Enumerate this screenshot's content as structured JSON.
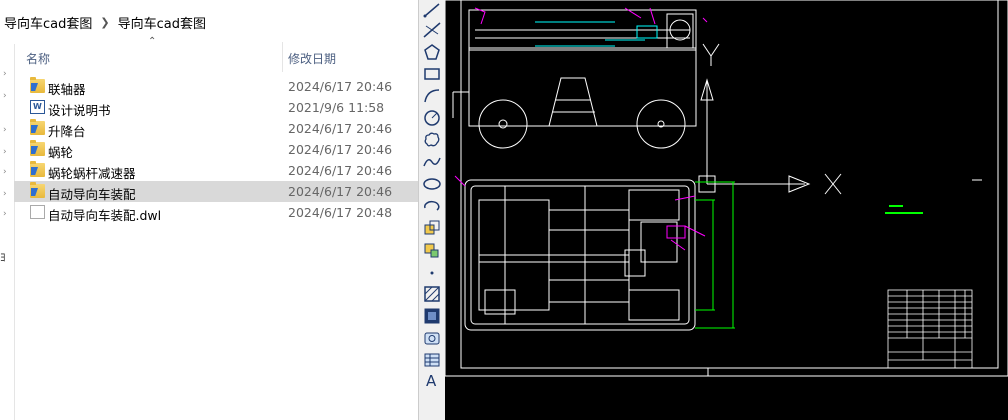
{
  "explorer": {
    "breadcrumb": [
      "导向车cad套图",
      "导向车cad套图"
    ],
    "columns": {
      "name": "名称",
      "date": "修改日期"
    },
    "left_pane_label": "ﾖ",
    "files": [
      {
        "name": "联轴器",
        "date": "2024/6/17 20:46",
        "icon": "folder-icon",
        "selected": false
      },
      {
        "name": "设计说明书",
        "date": "2021/9/6 11:58",
        "icon": "word-doc-icon",
        "selected": false
      },
      {
        "name": "升降台",
        "date": "2024/6/17 20:46",
        "icon": "folder-icon",
        "selected": false
      },
      {
        "name": "蜗轮",
        "date": "2024/6/17 20:46",
        "icon": "folder-icon",
        "selected": false
      },
      {
        "name": "蜗轮蜗杆减速器",
        "date": "2024/6/17 20:46",
        "icon": "folder-icon",
        "selected": false
      },
      {
        "name": "自动导向车装配",
        "date": "2024/6/17 20:46",
        "icon": "folder-icon",
        "selected": true
      },
      {
        "name": "自动导向车装配.dwl",
        "date": "2024/6/17 20:48",
        "icon": "file-icon",
        "selected": false
      }
    ]
  },
  "cad": {
    "ucs_y_label": "Y",
    "ucs_x_label": "X",
    "toolbar_text_tool": "A",
    "colors": {
      "background": "#000000",
      "lines": "#ffffff",
      "accent_green": "#00ff00",
      "accent_cyan": "#00ffff",
      "accent_magenta": "#ff00ff"
    }
  }
}
